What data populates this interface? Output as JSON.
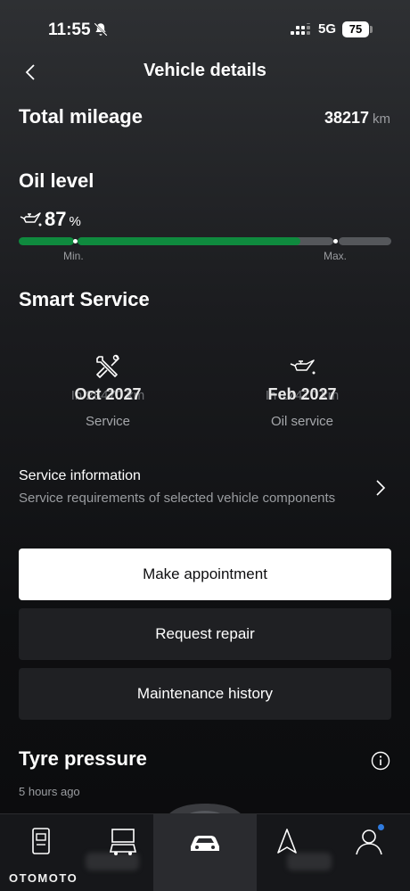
{
  "status_bar": {
    "time": "11:55",
    "network": "5G",
    "battery": "75"
  },
  "header": {
    "title": "Vehicle details"
  },
  "mileage": {
    "heading": "Total mileage",
    "value": "38217",
    "unit": "km"
  },
  "oil": {
    "heading": "Oil level",
    "value": "87",
    "unit": "%",
    "level_fraction": 0.87,
    "min_label": "Min.",
    "max_label": "Max."
  },
  "smart_service": {
    "heading": "Smart Service",
    "items": [
      {
        "icon": "wrench-screwdriver-icon",
        "ghost_text": "In 28470 km",
        "date": "Oct 2027",
        "label": "Service"
      },
      {
        "icon": "oil-can-icon",
        "ghost_text": "In 17470 km",
        "date": "Feb 2027",
        "label": "Oil service"
      }
    ]
  },
  "service_information": {
    "title": "Service information",
    "subtitle": "Service requirements of selected vehicle components"
  },
  "buttons": {
    "appointment": "Make appointment",
    "repair": "Request repair",
    "history": "Maintenance history"
  },
  "tyre": {
    "heading": "Tyre pressure",
    "updated": "5 hours ago"
  },
  "nav": {
    "items": [
      "phone-card-icon",
      "car-service-icon",
      "car-icon",
      "navigation-arrow-icon",
      "profile-icon"
    ],
    "active_index": 2
  },
  "watermark": "OTOMOTO",
  "colors": {
    "accent_green": "#0f8a3e",
    "notification_dot": "#2f7bdf"
  }
}
